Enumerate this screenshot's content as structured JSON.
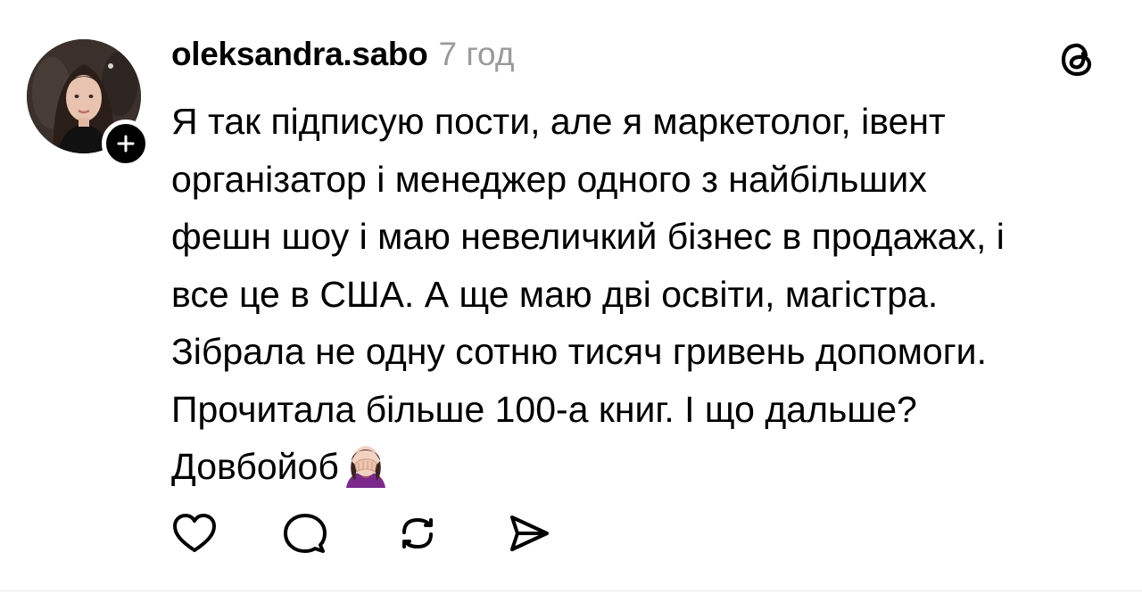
{
  "post": {
    "username": "oleksandra.sabo",
    "timestamp": "7 год",
    "text": "Я так підписую пости, але я маркетолог, івент\nорганізатор і менеджер одного з найбільших\nфешн шоу і маю невеличкий бізнес в продажах, і\nвсе це в США. А ще маю дві освіти, магістра.\nЗібрала не одну сотню тисяч гривень допомоги.\nПрочитала більше 100-а книг. І що дальше?\nДовбойоб",
    "trailing_emoji": "woman-facepalming"
  },
  "icons": {
    "follow": "plus-icon",
    "brand": "threads-logo",
    "like": "heart-icon",
    "reply": "comment-icon",
    "repost": "repost-icon",
    "share": "send-icon"
  },
  "colors": {
    "text": "#000000",
    "timestamp": "#9a9a9a",
    "icon": "#000000",
    "background": "#ffffff"
  }
}
